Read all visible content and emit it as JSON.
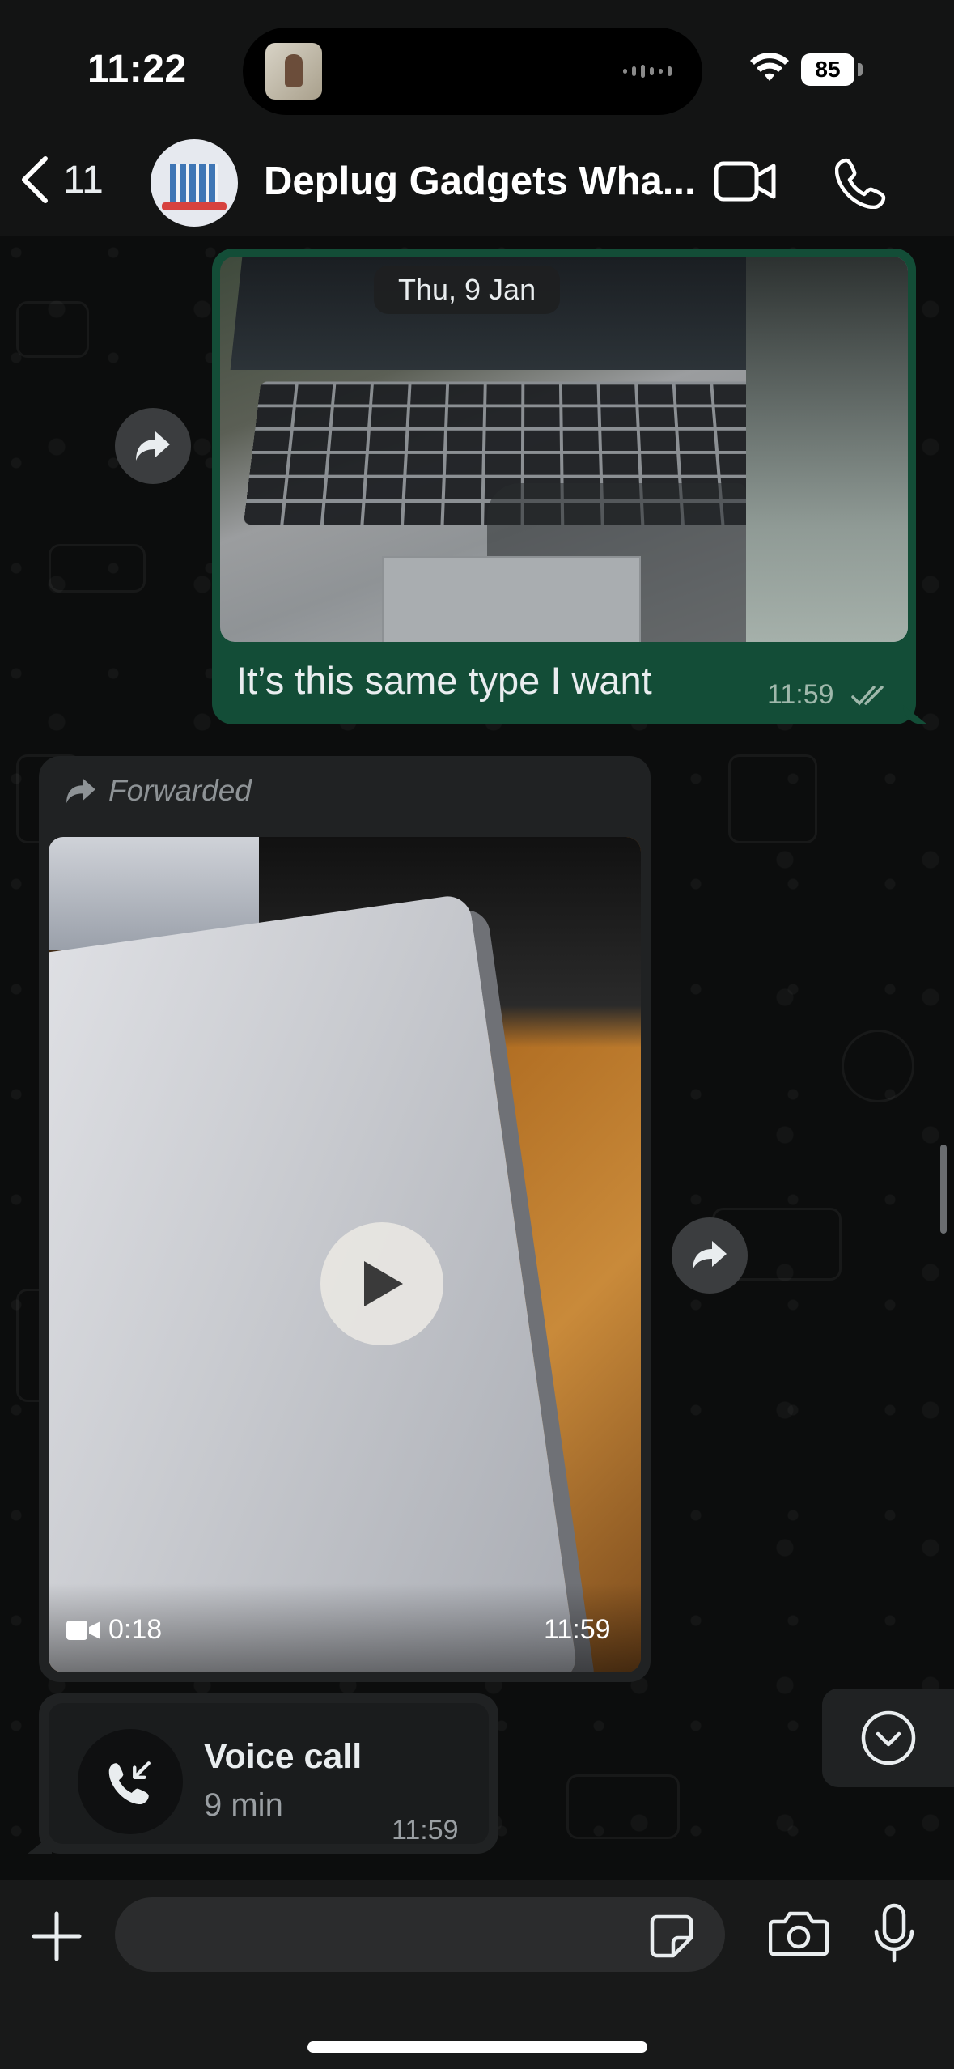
{
  "status_bar": {
    "time": "11:22",
    "battery": "85"
  },
  "header": {
    "back_count": "11",
    "title": "Deplug Gadgets Wha..."
  },
  "date_separator": "Thu, 9 Jan",
  "messages": [
    {
      "type": "image",
      "direction": "outgoing",
      "text": "It’s this same type I want",
      "time": "11:59"
    },
    {
      "type": "video",
      "direction": "incoming",
      "forwarded_label": "Forwarded",
      "duration": "0:18",
      "time": "11:59"
    },
    {
      "type": "call",
      "direction": "incoming",
      "title": "Voice call",
      "duration": "9 min",
      "time": "11:59"
    }
  ],
  "icons": [
    "chevron-left-icon",
    "video-camera-icon",
    "phone-icon",
    "forward-icon",
    "play-icon",
    "double-check-icon",
    "incoming-call-icon",
    "chevron-down-circle-icon",
    "plus-icon",
    "sticker-icon",
    "camera-icon",
    "microphone-icon"
  ],
  "colors": {
    "outgoing_bubble": "#134d37",
    "incoming_bubble": "#202223",
    "background": "#0b0c0c"
  }
}
